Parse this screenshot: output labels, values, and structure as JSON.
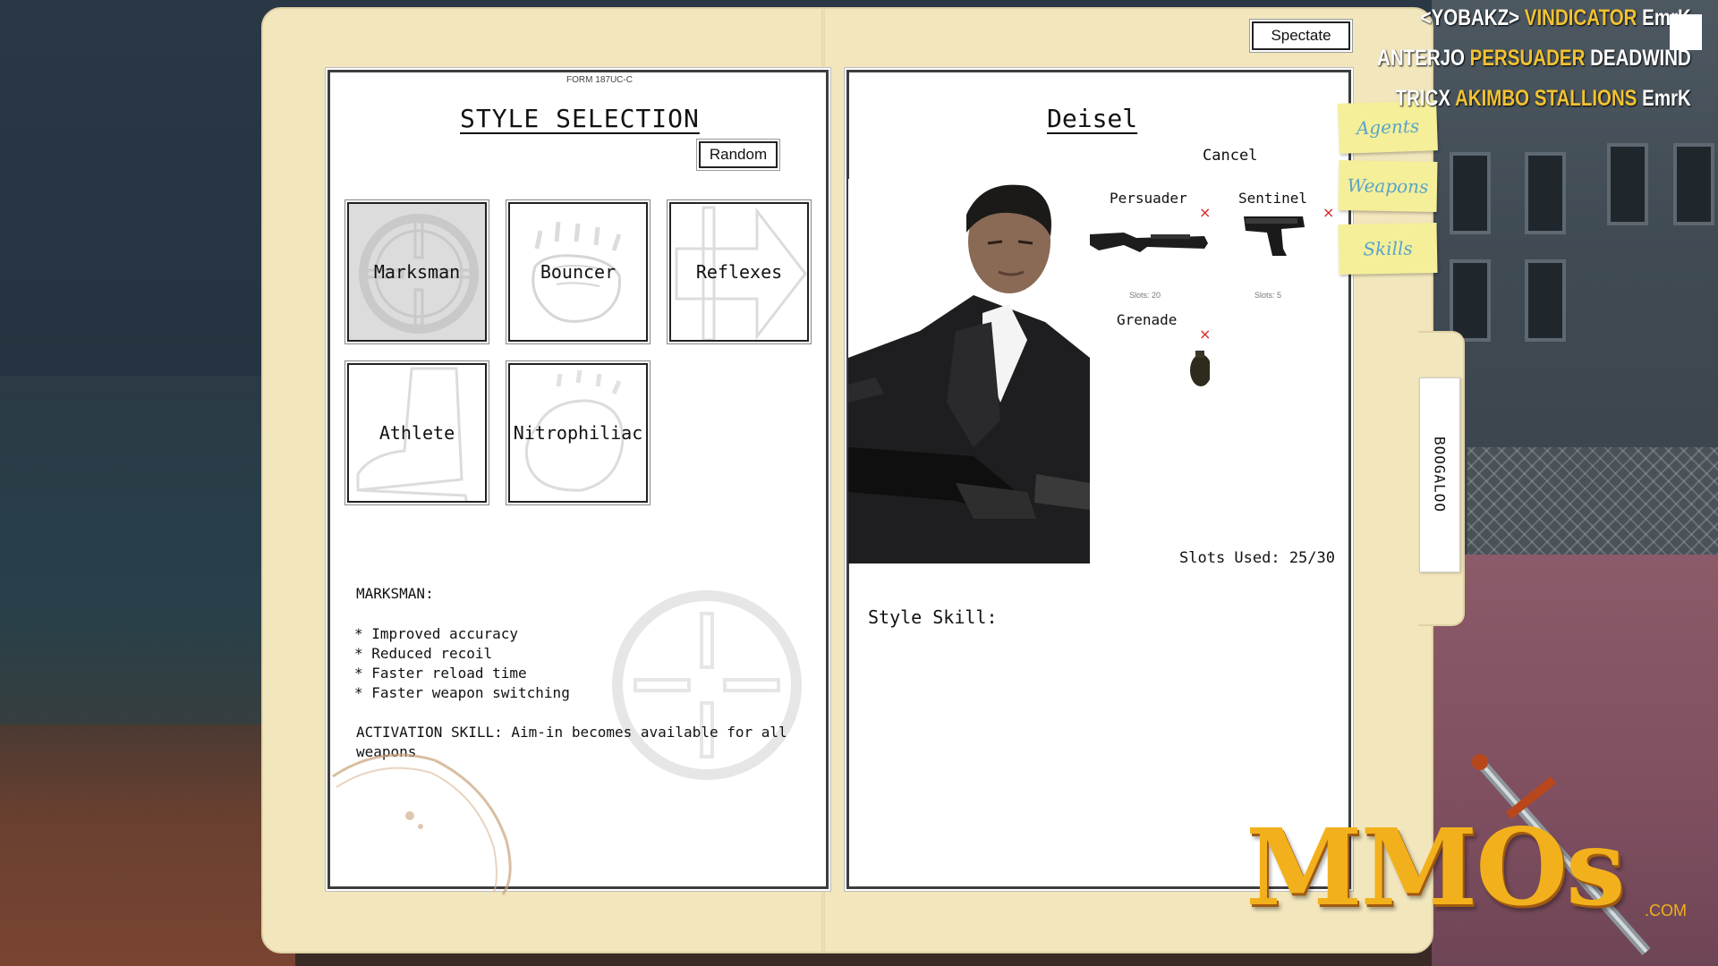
{
  "header": {
    "spectate_label": "Spectate"
  },
  "left_page": {
    "form_id": "FORM 187UC-C",
    "title": "STYLE SELECTION",
    "random_label": "Random",
    "styles": [
      {
        "label": "Marksman",
        "icon": "crosshair-icon",
        "selected": true
      },
      {
        "label": "Bouncer",
        "icon": "fist-icon",
        "selected": false
      },
      {
        "label": "Reflexes",
        "icon": "arrow-icon",
        "selected": false
      },
      {
        "label": "Athlete",
        "icon": "boot-icon",
        "selected": false
      },
      {
        "label": "Nitrophiliac",
        "icon": "explosion-icon",
        "selected": false
      }
    ],
    "description": {
      "heading": "MARKSMAN:",
      "bullets": [
        "* Improved accuracy",
        "* Reduced recoil",
        "* Faster reload time",
        "* Faster weapon switching"
      ],
      "activation": "ACTIVATION SKILL: Aim-in becomes available for all weapons"
    }
  },
  "right_page": {
    "agent_name": "Deisel",
    "cancel_label": "Cancel",
    "weapons": [
      {
        "name": "Persuader",
        "icon": "shotgun-icon",
        "slots": "Slots: 20"
      },
      {
        "name": "Sentinel",
        "icon": "pistol-icon",
        "slots": "Slots: 5"
      },
      {
        "name": "Grenade",
        "icon": "grenade-icon",
        "slots": ""
      }
    ],
    "remove_symbol": "×",
    "slots_used": "Slots Used: 25/30",
    "style_skill_label": "Style Skill:"
  },
  "nav_tabs": [
    "Agents",
    "Weapons",
    "Skills"
  ],
  "side_tab": "BOOGALOO",
  "killfeed": [
    {
      "killer": "<YOBAKZ>",
      "weapon": "VINDICATOR",
      "victim": "EmrK"
    },
    {
      "killer": "ANTERJO",
      "weapon": "PERSUADER",
      "victim": "DEADWIND"
    },
    {
      "killer": "TRICX",
      "weapon": "AKIMBO STALLIONS",
      "victim": "EmrK"
    }
  ],
  "watermark": {
    "text": "MMOs",
    "suffix": ".COM"
  },
  "colors": {
    "folder": "#f2e6bd",
    "tab": "#f5ef9a",
    "tab_text": "#5aa4c8",
    "kill_weapon": "#f1c232",
    "remove_x": "#dd2222"
  }
}
